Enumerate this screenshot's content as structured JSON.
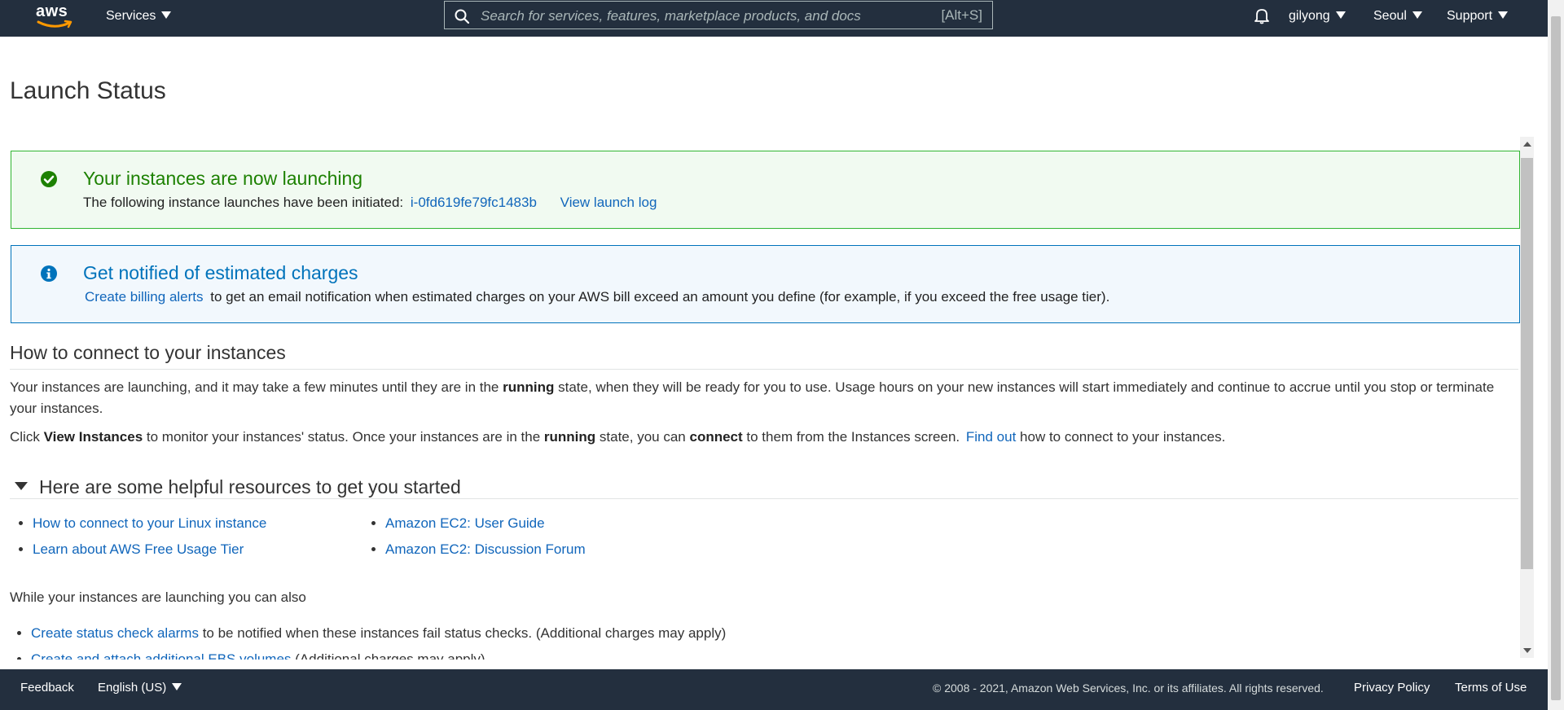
{
  "topnav": {
    "logo_text": "aws",
    "services_label": "Services",
    "search": {
      "placeholder": "Search for services, features, marketplace products, and docs",
      "shortcut": "[Alt+S]"
    },
    "user_label": "gilyong",
    "region_label": "Seoul",
    "support_label": "Support"
  },
  "page": {
    "title": "Launch Status"
  },
  "success_alert": {
    "title": "Your instances are now launching",
    "body_prefix": "The following instance launches have been initiated:",
    "instance_id": "i-0fd619fe79fc1483b",
    "view_log_label": "View launch log"
  },
  "info_alert": {
    "title": "Get notified of estimated charges",
    "link_label": "Create billing alerts",
    "body_suffix": "to get an email notification when estimated charges on your AWS bill exceed an amount you define (for example, if you exceed the free usage tier)."
  },
  "connect_section": {
    "heading": "How to connect to your instances",
    "para1": {
      "before": "Your instances are launching, and it may take a few minutes until they are in the",
      "bold": "running",
      "after": "state, when they will be ready for you to use. Usage hours on your new instances will start immediately and continue to accrue until you stop or terminate your instances."
    },
    "para2": {
      "t1": "Click",
      "b1": "View Instances",
      "t2": "to monitor your instances' status. Once your instances are in the",
      "b2": "running",
      "t3": "state, you can",
      "b3": "connect",
      "t4": "to them from the Instances screen.",
      "link": "Find out",
      "t5": "how to connect to your instances."
    }
  },
  "resources": {
    "heading": "Here are some helpful resources to get you started",
    "left_links": [
      "How to connect to your Linux instance",
      "Learn about AWS Free Usage Tier"
    ],
    "right_links": [
      "Amazon EC2: User Guide",
      "Amazon EC2: Discussion Forum"
    ]
  },
  "also": {
    "heading": "While your instances are launching you can also",
    "items": [
      {
        "link": "Create status check alarms",
        "text": "to be notified when these instances fail status checks. (Additional charges may apply)"
      },
      {
        "link": "Create and attach additional EBS volumes",
        "text": "(Additional charges may apply)"
      }
    ]
  },
  "footer": {
    "feedback_label": "Feedback",
    "language_label": "English (US)",
    "copyright": "© 2008 - 2021, Amazon Web Services, Inc. or its affiliates. All rights reserved.",
    "privacy_label": "Privacy Policy",
    "terms_label": "Terms of Use"
  },
  "colors": {
    "nav_bg": "#232f3e",
    "link": "#1166bb",
    "success": "#1d8102",
    "info": "#0073bb"
  }
}
